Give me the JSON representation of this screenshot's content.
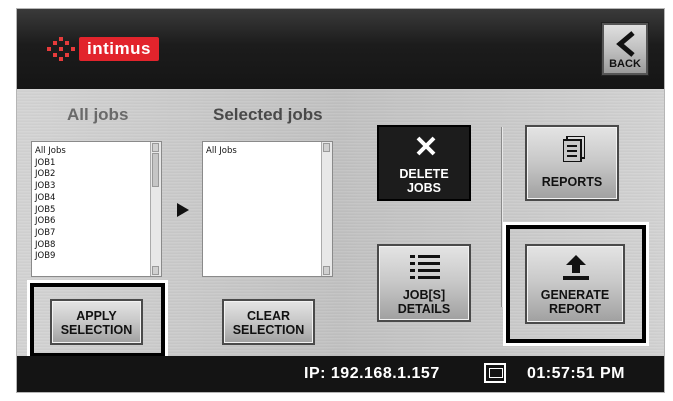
{
  "header": {
    "brand": "intimus",
    "back_label": "BACK"
  },
  "left_list": {
    "title": "All jobs",
    "items": [
      "All Jobs",
      "JOB1",
      "JOB2",
      "JOB3",
      "JOB4",
      "JOB5",
      "JOB6",
      "JOB7",
      "JOB8",
      "JOB9"
    ]
  },
  "right_list": {
    "title": "Selected jobs",
    "items": [
      "All Jobs"
    ]
  },
  "buttons": {
    "apply_line1": "APPLY",
    "apply_line2": "SELECTION",
    "clear_line1": "CLEAR",
    "clear_line2": "SELECTION",
    "delete_line1": "DELETE",
    "delete_line2": "JOBS",
    "details_line1": "JOB[S]",
    "details_line2": "DETAILS",
    "reports_label": "REPORTS",
    "generate_line1": "GENERATE",
    "generate_line2": "REPORT"
  },
  "footer": {
    "ip": "IP: 192.168.1.157",
    "time": "01:57:51 PM"
  },
  "colors": {
    "brand_red": "#e2242c",
    "header_bg": "#1c1c1c",
    "footer_bg": "#141414",
    "panel_bg": "#cccccc"
  }
}
